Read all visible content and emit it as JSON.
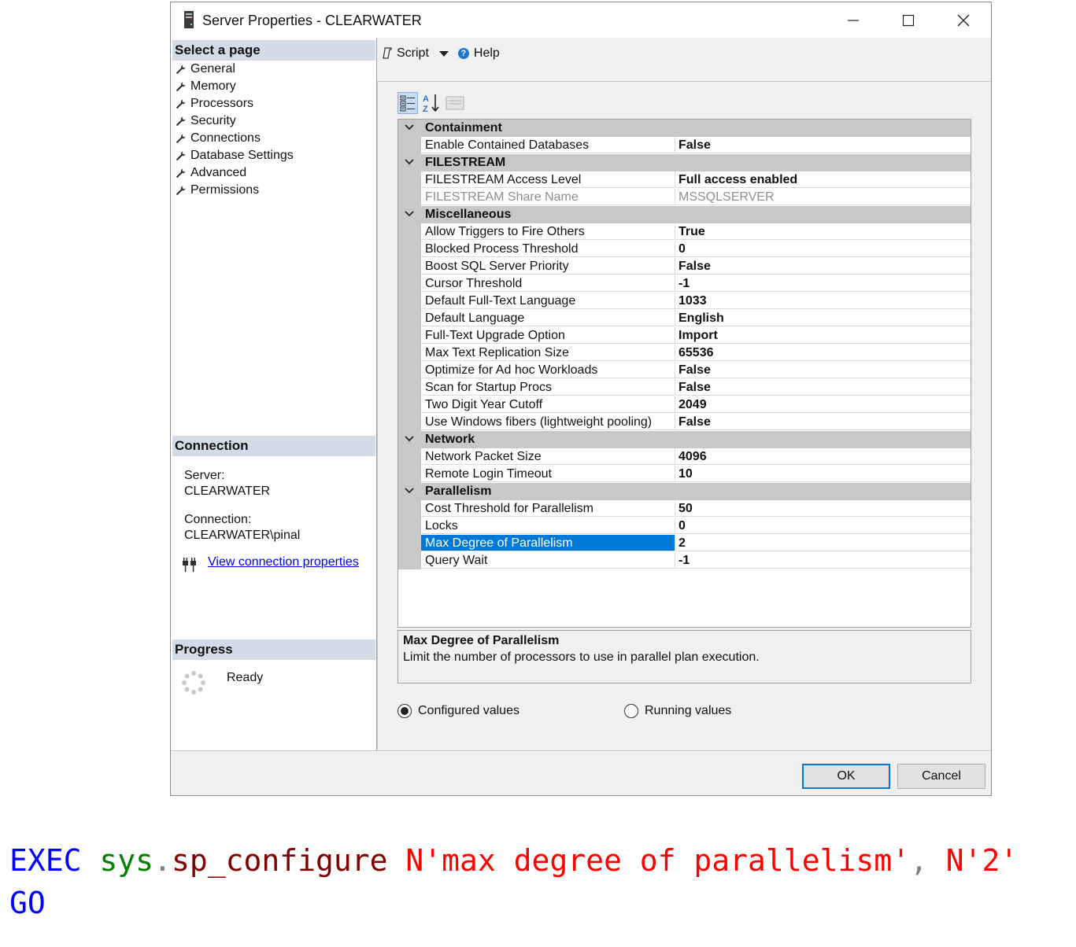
{
  "window": {
    "title": "Server Properties - CLEARWATER"
  },
  "left_pane": {
    "select_page_header": "Select a page",
    "pages": [
      "General",
      "Memory",
      "Processors",
      "Security",
      "Connections",
      "Database Settings",
      "Advanced",
      "Permissions"
    ],
    "connection": {
      "header": "Connection",
      "server_label": "Server:",
      "server_value": "CLEARWATER",
      "connection_label": "Connection:",
      "connection_value": "CLEARWATER\\pinal",
      "link": "View connection properties"
    },
    "progress": {
      "header": "Progress",
      "status": "Ready"
    }
  },
  "toolbar": {
    "script_label": "Script",
    "help_label": "Help"
  },
  "property_grid": {
    "categories": [
      {
        "name": "Containment",
        "properties": [
          {
            "name": "Enable Contained Databases",
            "value": "False"
          }
        ]
      },
      {
        "name": "FILESTREAM",
        "properties": [
          {
            "name": "FILESTREAM Access Level",
            "value": "Full access enabled"
          },
          {
            "name": "FILESTREAM Share Name",
            "value": "MSSQLSERVER",
            "disabled": true
          }
        ]
      },
      {
        "name": "Miscellaneous",
        "properties": [
          {
            "name": "Allow Triggers to Fire Others",
            "value": "True"
          },
          {
            "name": "Blocked Process Threshold",
            "value": "0"
          },
          {
            "name": "Boost SQL Server Priority",
            "value": "False"
          },
          {
            "name": "Cursor Threshold",
            "value": "-1"
          },
          {
            "name": "Default Full-Text Language",
            "value": "1033"
          },
          {
            "name": "Default Language",
            "value": "English"
          },
          {
            "name": "Full-Text Upgrade Option",
            "value": "Import"
          },
          {
            "name": "Max Text Replication Size",
            "value": "65536"
          },
          {
            "name": "Optimize for Ad hoc Workloads",
            "value": "False"
          },
          {
            "name": "Scan for Startup Procs",
            "value": "False"
          },
          {
            "name": "Two Digit Year Cutoff",
            "value": "2049"
          },
          {
            "name": "Use Windows fibers (lightweight pooling)",
            "value": "False"
          }
        ]
      },
      {
        "name": "Network",
        "properties": [
          {
            "name": "Network Packet Size",
            "value": "4096"
          },
          {
            "name": "Remote Login Timeout",
            "value": "10"
          }
        ]
      },
      {
        "name": "Parallelism",
        "properties": [
          {
            "name": "Cost Threshold for Parallelism",
            "value": "50"
          },
          {
            "name": "Locks",
            "value": "0"
          },
          {
            "name": "Max Degree of Parallelism",
            "value": "2",
            "selected": true
          },
          {
            "name": "Query Wait",
            "value": "-1"
          }
        ]
      }
    ],
    "selection_color": "#0078d7"
  },
  "description": {
    "title": "Max Degree of Parallelism",
    "text": "Limit the number of processors to use in parallel plan execution."
  },
  "radio": {
    "configured_label": "Configured values",
    "running_label": "Running values",
    "selected": "configured"
  },
  "buttons": {
    "ok": "OK",
    "cancel": "Cancel"
  },
  "code": {
    "exec": "EXEC",
    "sys": "sys",
    "dot": ".",
    "proc": "sp_configure",
    "arg1": "N'max degree of parallelism'",
    "comma": ",",
    "arg2": "N'2'",
    "go": "GO"
  }
}
